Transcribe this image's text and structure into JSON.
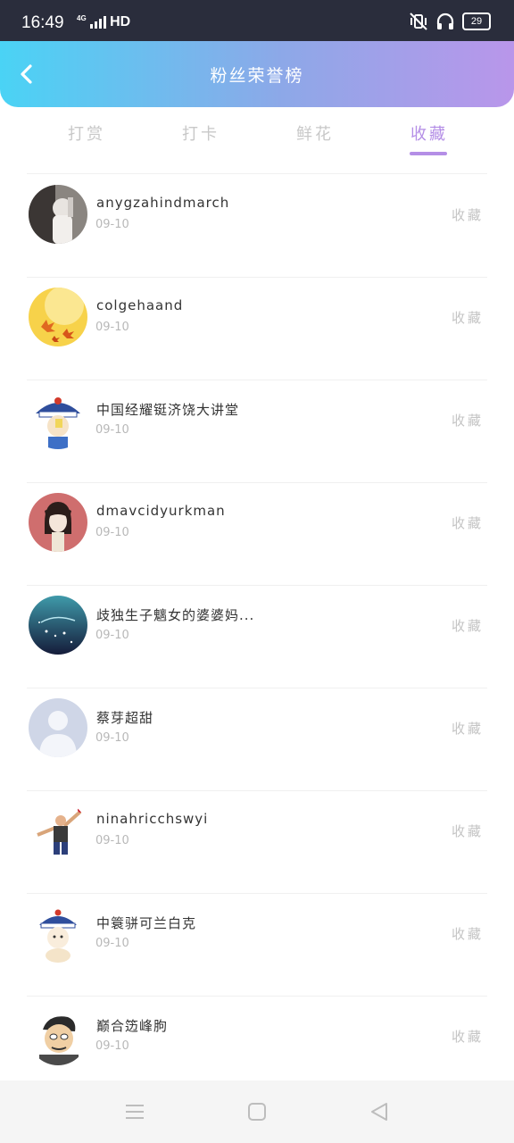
{
  "status_bar": {
    "time": "16:49",
    "network": "HD",
    "network_gen": "4G",
    "battery": "29"
  },
  "header": {
    "title": "粉丝荣誉榜"
  },
  "tabs": [
    {
      "label": "打赏",
      "active": false
    },
    {
      "label": "打卡",
      "active": false
    },
    {
      "label": "鲜花",
      "active": false
    },
    {
      "label": "收藏",
      "active": true
    }
  ],
  "list": {
    "items": [
      {
        "name": "anygzahindmarch",
        "date": "09-10",
        "action": "收藏",
        "avatar": "person-photo-avatar"
      },
      {
        "name": "colgehaand",
        "date": "09-10",
        "action": "收藏",
        "avatar": "autumn-leaves-avatar"
      },
      {
        "name": "中国经耀铤济饶大讲堂",
        "date": "09-10",
        "action": "收藏",
        "avatar": "cartoon-qing-official-avatar"
      },
      {
        "name": "dmavcidyurkman",
        "date": "09-10",
        "action": "收藏",
        "avatar": "anime-girl-avatar"
      },
      {
        "name": "歧独生子魑女的婆婆妈...",
        "date": "09-10",
        "action": "收藏",
        "avatar": "night-sky-avatar"
      },
      {
        "name": "蔡芽超甜",
        "date": "09-10",
        "action": "收藏",
        "avatar": "default-user-avatar"
      },
      {
        "name": "ninahricchswyi",
        "date": "09-10",
        "action": "收藏",
        "avatar": "cartoon-dancer-avatar"
      },
      {
        "name": "中簑骈可兰白克",
        "date": "09-10",
        "action": "收藏",
        "avatar": "cartoon-qing-official-avatar"
      },
      {
        "name": "巅合笾峰朐",
        "date": "09-10",
        "action": "收藏",
        "avatar": "cartoon-man-avatar"
      }
    ]
  },
  "accent_color": "#b48ee6",
  "header_gradient": [
    "#4ad3f5",
    "#b996ea"
  ]
}
